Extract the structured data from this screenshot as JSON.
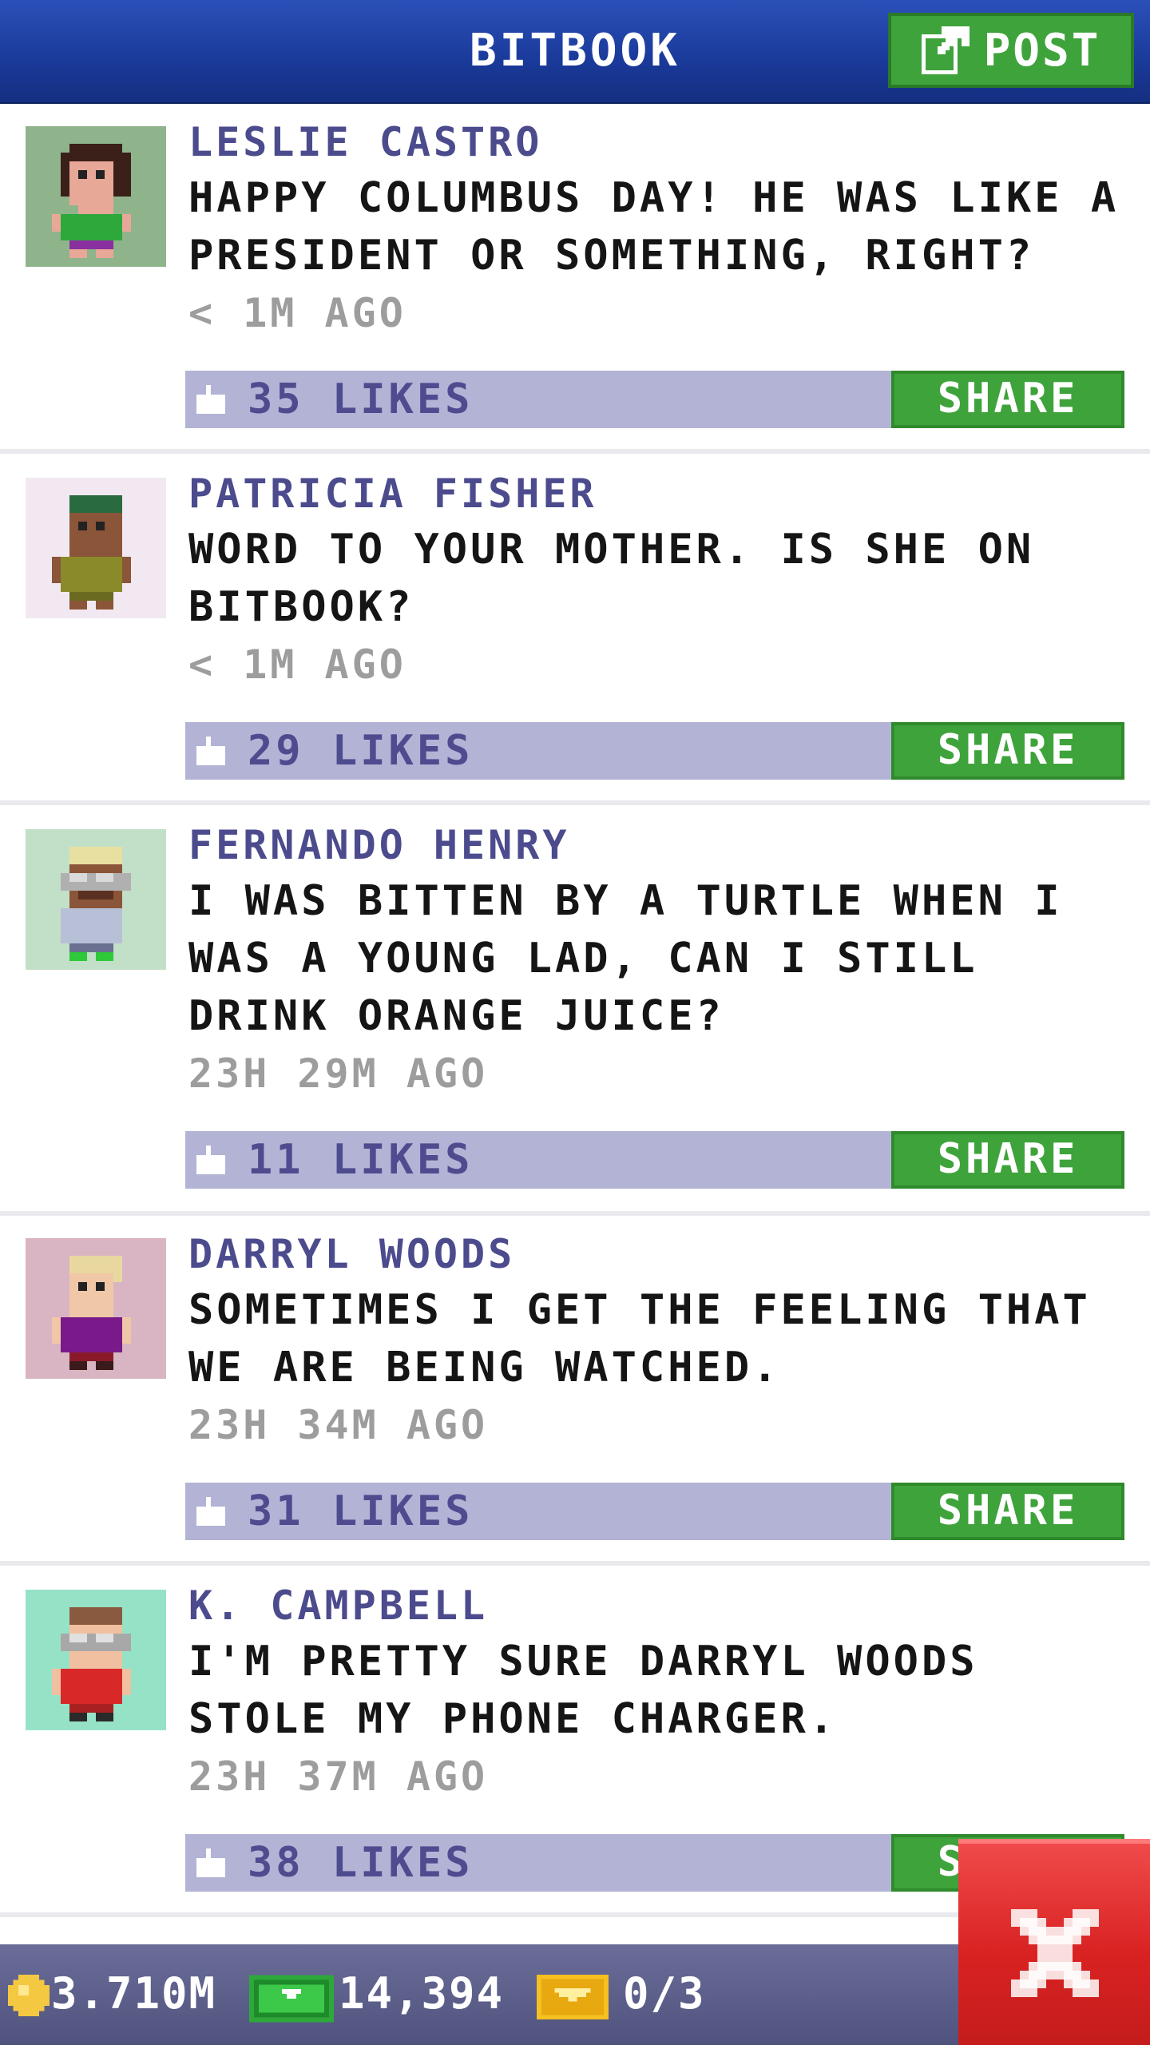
{
  "header": {
    "title": "BITBOOK",
    "post_label": "POST"
  },
  "posts": [
    {
      "name": "LESLIE CASTRO",
      "message": "HAPPY COLUMBUS DAY! HE WAS LIKE A PRESIDENT OR SOMETHING, RIGHT?",
      "time": "< 1M AGO",
      "likes": "35 LIKES",
      "share": "SHARE",
      "avatar_bg": "#8fb48c"
    },
    {
      "name": "PATRICIA FISHER",
      "message": "WORD TO YOUR MOTHER. IS SHE ON BITBOOK?",
      "time": "< 1M AGO",
      "likes": "29 LIKES",
      "share": "SHARE",
      "avatar_bg": "#f2e8f2"
    },
    {
      "name": "FERNANDO HENRY",
      "message": "I WAS BITTEN BY A TURTLE WHEN I WAS A YOUNG LAD, CAN I STILL DRINK ORANGE JUICE?",
      "time": "23H 29M AGO",
      "likes": "11 LIKES",
      "share": "SHARE",
      "avatar_bg": "#c2dfc8"
    },
    {
      "name": "DARRYL WOODS",
      "message": "SOMETIMES I GET THE FEELING THAT WE ARE BEING WATCHED.",
      "time": "23H 34M AGO",
      "likes": "31 LIKES",
      "share": "SHARE",
      "avatar_bg": "#d9b4c2"
    },
    {
      "name": "K. CAMPBELL",
      "message": "I'M PRETTY SURE DARRYL WOODS STOLE MY PHONE CHARGER.",
      "time": "23H 37M AGO",
      "likes": "38 LIKES",
      "share": "SHARE",
      "avatar_bg": "#96e2c6"
    }
  ],
  "status": {
    "coins": "3.710M",
    "bux": "14,394",
    "tickets": "0/3"
  },
  "colors": {
    "header_blue": "#1f44a8",
    "share_green": "#3fa33b",
    "like_bar": "#b3b3d6",
    "name_purple": "#4c4b8d",
    "close_red": "#d92222"
  }
}
